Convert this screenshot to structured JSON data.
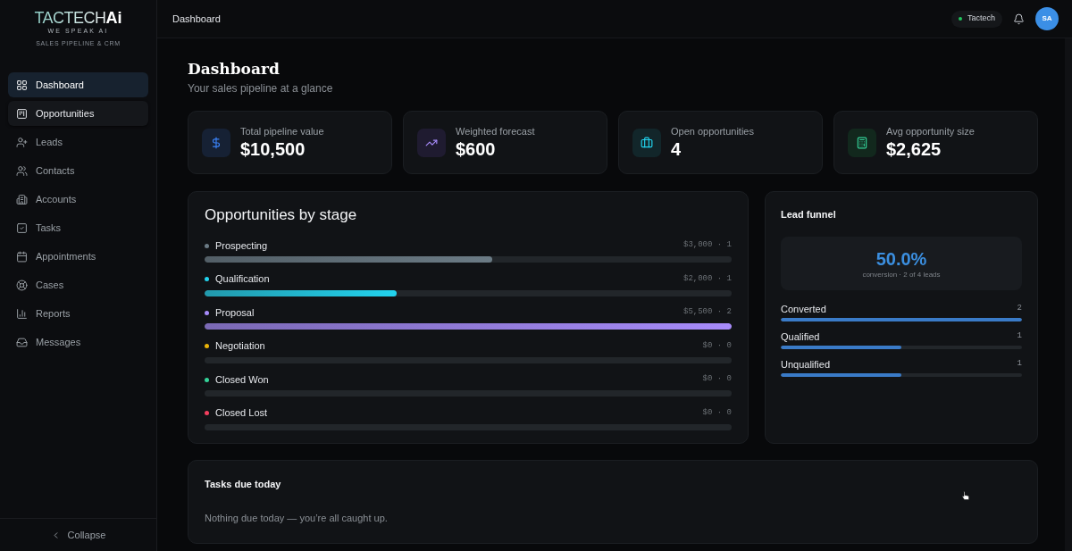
{
  "sidebar": {
    "logo": {
      "name": "TACTECH",
      "suffix": "Ai",
      "tagline": "WE SPEAK AI"
    },
    "subtitle": "SALES PIPELINE & CRM",
    "items": [
      {
        "label": "Dashboard",
        "selected": true,
        "hovered": false
      },
      {
        "label": "Opportunities",
        "selected": false,
        "hovered": true
      },
      {
        "label": "Leads",
        "selected": false,
        "hovered": false
      },
      {
        "label": "Contacts",
        "selected": false,
        "hovered": false
      },
      {
        "label": "Accounts",
        "selected": false,
        "hovered": false
      },
      {
        "label": "Tasks",
        "selected": false,
        "hovered": false
      },
      {
        "label": "Appointments",
        "selected": false,
        "hovered": false
      },
      {
        "label": "Cases",
        "selected": false,
        "hovered": false
      },
      {
        "label": "Reports",
        "selected": false,
        "hovered": false
      },
      {
        "label": "Messages",
        "selected": false,
        "hovered": false
      }
    ],
    "collapse_label": "Collapse"
  },
  "topbar": {
    "title": "Dashboard",
    "workspace": "Tactech",
    "avatar": "SA"
  },
  "page": {
    "title": "Dashboard",
    "subtitle": "Your sales pipeline at a glance"
  },
  "stats": [
    {
      "label": "Total pipeline value",
      "value": "$10,500"
    },
    {
      "label": "Weighted forecast",
      "value": "$600"
    },
    {
      "label": "Open opportunities",
      "value": "4"
    },
    {
      "label": "Avg opportunity size",
      "value": "$2,625"
    }
  ],
  "stages": {
    "title": "Opportunities by stage",
    "items": [
      {
        "name": "Prospecting",
        "color": "#6b7b85",
        "summary": "$3,000 · 1",
        "level": 0.545
      },
      {
        "name": "Qualification",
        "color": "#22d3ee",
        "summary": "$2,000 · 1",
        "level": 0.364
      },
      {
        "name": "Proposal",
        "color": "#a78bfa",
        "summary": "$5,500 · 2",
        "level": 1
      },
      {
        "name": "Negotiation",
        "color": "#eab308",
        "summary": "$0 · 0",
        "level": 0
      },
      {
        "name": "Closed Won",
        "color": "#34d399",
        "summary": "$0 · 0",
        "level": 0
      },
      {
        "name": "Closed Lost",
        "color": "#f43f5e",
        "summary": "$0 · 0",
        "level": 0
      }
    ]
  },
  "lead_funnel": {
    "title": "Lead funnel",
    "rate": "50.0%",
    "caption": "conversion · 2 of 4 leads",
    "rows": [
      {
        "label": "Converted",
        "count": "2",
        "level": 1
      },
      {
        "label": "Qualified",
        "count": "1",
        "level": 0.5
      },
      {
        "label": "Unqualified",
        "count": "1",
        "level": 0.5
      }
    ]
  },
  "tasks": {
    "title": "Tasks due today",
    "empty": "Nothing due today — you’re all caught up."
  }
}
